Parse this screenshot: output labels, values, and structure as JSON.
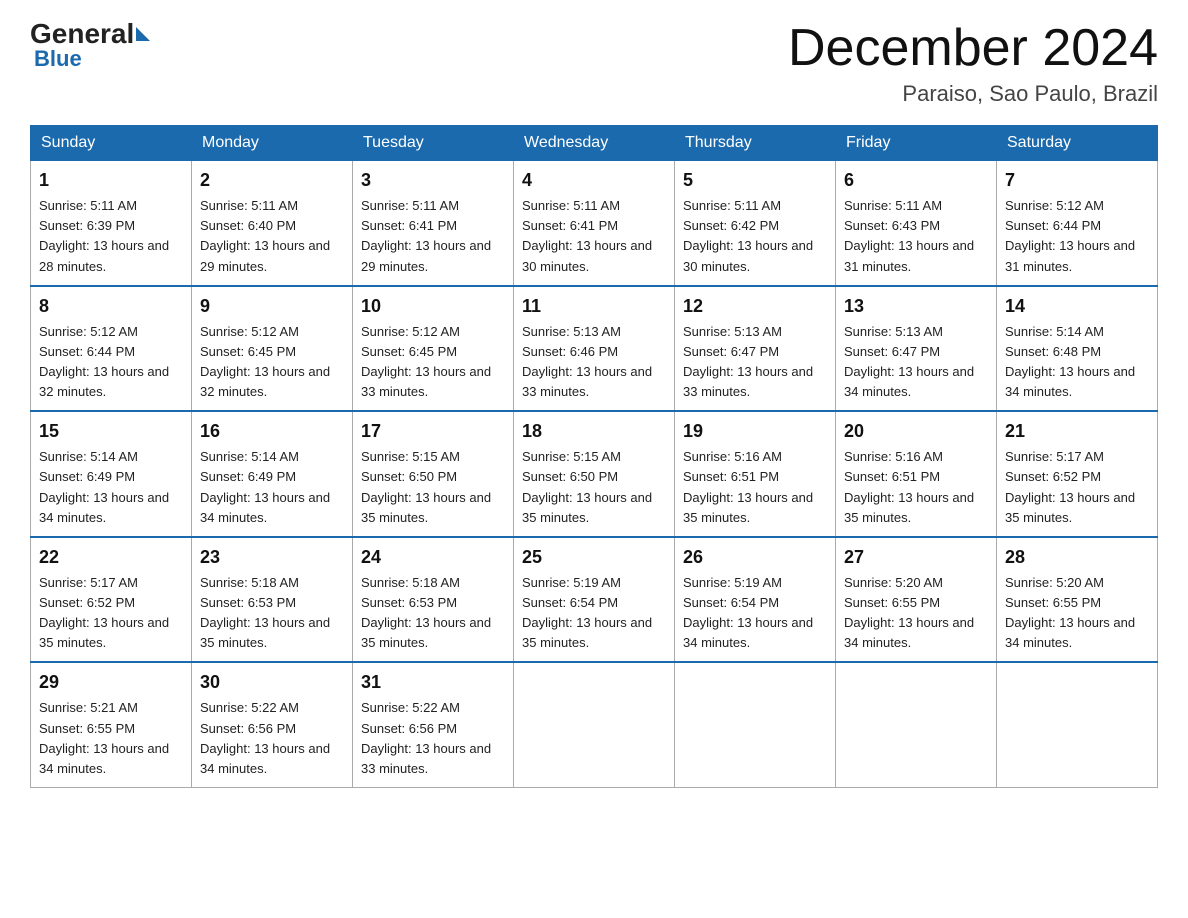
{
  "header": {
    "logo_general": "General",
    "logo_blue": "Blue",
    "month_title": "December 2024",
    "location": "Paraiso, Sao Paulo, Brazil"
  },
  "days_of_week": [
    "Sunday",
    "Monday",
    "Tuesday",
    "Wednesday",
    "Thursday",
    "Friday",
    "Saturday"
  ],
  "weeks": [
    [
      {
        "day": "1",
        "sunrise": "5:11 AM",
        "sunset": "6:39 PM",
        "daylight": "13 hours and 28 minutes."
      },
      {
        "day": "2",
        "sunrise": "5:11 AM",
        "sunset": "6:40 PM",
        "daylight": "13 hours and 29 minutes."
      },
      {
        "day": "3",
        "sunrise": "5:11 AM",
        "sunset": "6:41 PM",
        "daylight": "13 hours and 29 minutes."
      },
      {
        "day": "4",
        "sunrise": "5:11 AM",
        "sunset": "6:41 PM",
        "daylight": "13 hours and 30 minutes."
      },
      {
        "day": "5",
        "sunrise": "5:11 AM",
        "sunset": "6:42 PM",
        "daylight": "13 hours and 30 minutes."
      },
      {
        "day": "6",
        "sunrise": "5:11 AM",
        "sunset": "6:43 PM",
        "daylight": "13 hours and 31 minutes."
      },
      {
        "day": "7",
        "sunrise": "5:12 AM",
        "sunset": "6:44 PM",
        "daylight": "13 hours and 31 minutes."
      }
    ],
    [
      {
        "day": "8",
        "sunrise": "5:12 AM",
        "sunset": "6:44 PM",
        "daylight": "13 hours and 32 minutes."
      },
      {
        "day": "9",
        "sunrise": "5:12 AM",
        "sunset": "6:45 PM",
        "daylight": "13 hours and 32 minutes."
      },
      {
        "day": "10",
        "sunrise": "5:12 AM",
        "sunset": "6:45 PM",
        "daylight": "13 hours and 33 minutes."
      },
      {
        "day": "11",
        "sunrise": "5:13 AM",
        "sunset": "6:46 PM",
        "daylight": "13 hours and 33 minutes."
      },
      {
        "day": "12",
        "sunrise": "5:13 AM",
        "sunset": "6:47 PM",
        "daylight": "13 hours and 33 minutes."
      },
      {
        "day": "13",
        "sunrise": "5:13 AM",
        "sunset": "6:47 PM",
        "daylight": "13 hours and 34 minutes."
      },
      {
        "day": "14",
        "sunrise": "5:14 AM",
        "sunset": "6:48 PM",
        "daylight": "13 hours and 34 minutes."
      }
    ],
    [
      {
        "day": "15",
        "sunrise": "5:14 AM",
        "sunset": "6:49 PM",
        "daylight": "13 hours and 34 minutes."
      },
      {
        "day": "16",
        "sunrise": "5:14 AM",
        "sunset": "6:49 PM",
        "daylight": "13 hours and 34 minutes."
      },
      {
        "day": "17",
        "sunrise": "5:15 AM",
        "sunset": "6:50 PM",
        "daylight": "13 hours and 35 minutes."
      },
      {
        "day": "18",
        "sunrise": "5:15 AM",
        "sunset": "6:50 PM",
        "daylight": "13 hours and 35 minutes."
      },
      {
        "day": "19",
        "sunrise": "5:16 AM",
        "sunset": "6:51 PM",
        "daylight": "13 hours and 35 minutes."
      },
      {
        "day": "20",
        "sunrise": "5:16 AM",
        "sunset": "6:51 PM",
        "daylight": "13 hours and 35 minutes."
      },
      {
        "day": "21",
        "sunrise": "5:17 AM",
        "sunset": "6:52 PM",
        "daylight": "13 hours and 35 minutes."
      }
    ],
    [
      {
        "day": "22",
        "sunrise": "5:17 AM",
        "sunset": "6:52 PM",
        "daylight": "13 hours and 35 minutes."
      },
      {
        "day": "23",
        "sunrise": "5:18 AM",
        "sunset": "6:53 PM",
        "daylight": "13 hours and 35 minutes."
      },
      {
        "day": "24",
        "sunrise": "5:18 AM",
        "sunset": "6:53 PM",
        "daylight": "13 hours and 35 minutes."
      },
      {
        "day": "25",
        "sunrise": "5:19 AM",
        "sunset": "6:54 PM",
        "daylight": "13 hours and 35 minutes."
      },
      {
        "day": "26",
        "sunrise": "5:19 AM",
        "sunset": "6:54 PM",
        "daylight": "13 hours and 34 minutes."
      },
      {
        "day": "27",
        "sunrise": "5:20 AM",
        "sunset": "6:55 PM",
        "daylight": "13 hours and 34 minutes."
      },
      {
        "day": "28",
        "sunrise": "5:20 AM",
        "sunset": "6:55 PM",
        "daylight": "13 hours and 34 minutes."
      }
    ],
    [
      {
        "day": "29",
        "sunrise": "5:21 AM",
        "sunset": "6:55 PM",
        "daylight": "13 hours and 34 minutes."
      },
      {
        "day": "30",
        "sunrise": "5:22 AM",
        "sunset": "6:56 PM",
        "daylight": "13 hours and 34 minutes."
      },
      {
        "day": "31",
        "sunrise": "5:22 AM",
        "sunset": "6:56 PM",
        "daylight": "13 hours and 33 minutes."
      },
      null,
      null,
      null,
      null
    ]
  ]
}
